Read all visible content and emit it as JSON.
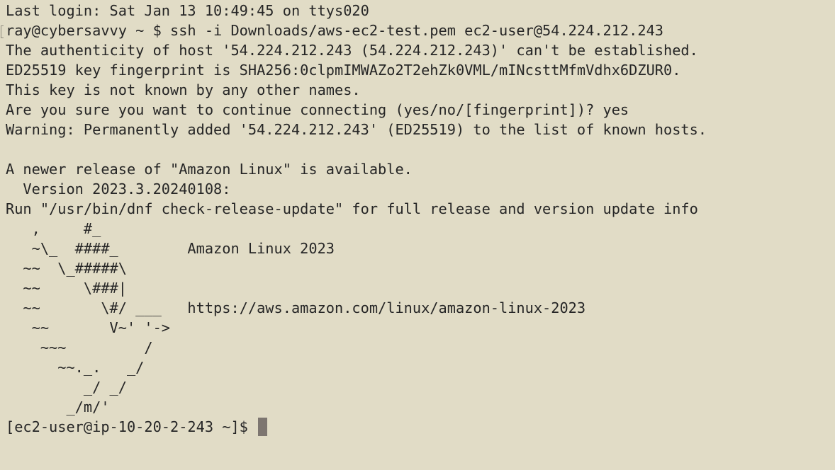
{
  "terminal": {
    "lines": [
      "Last login: Sat Jan 13 10:49:45 on ttys020",
      "ray@cybersavvy ~ $ ssh -i Downloads/aws-ec2-test.pem ec2-user@54.224.212.243",
      "The authenticity of host '54.224.212.243 (54.224.212.243)' can't be established.",
      "ED25519 key fingerprint is SHA256:0clpmIMWAZo2T2ehZk0VML/mINcsttMfmVdhx6DZUR0.",
      "This key is not known by any other names.",
      "Are you sure you want to continue connecting (yes/no/[fingerprint])? yes",
      "Warning: Permanently added '54.224.212.243' (ED25519) to the list of known hosts.",
      "",
      "A newer release of \"Amazon Linux\" is available.",
      "  Version 2023.3.20240108:",
      "Run \"/usr/bin/dnf check-release-update\" for full release and version update info",
      "   ,     #_",
      "   ~\\_  ####_        Amazon Linux 2023",
      "  ~~  \\_#####\\",
      "  ~~     \\###|",
      "  ~~       \\#/ ___   https://aws.amazon.com/linux/amazon-linux-2023",
      "   ~~       V~' '->",
      "    ~~~         /",
      "      ~~._.   _/",
      "         _/ _/",
      "       _/m/'"
    ],
    "prompt": "[ec2-user@ip-10-20-2-243 ~]$ "
  }
}
